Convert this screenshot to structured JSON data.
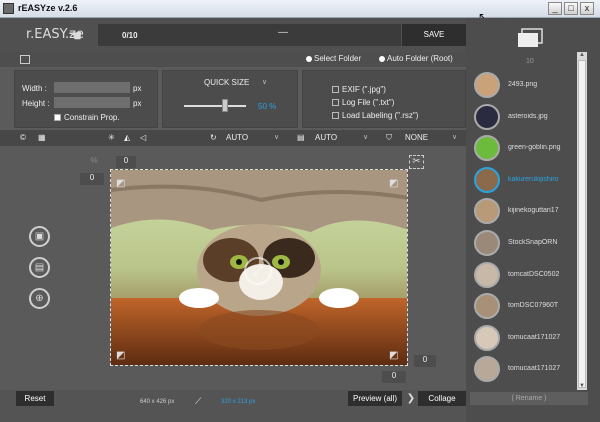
{
  "window": {
    "title": "rEASYze v.2.6",
    "controls": [
      "_",
      "□",
      "x"
    ]
  },
  "header": {
    "logo": "r.EASY.ze",
    "counter": "0/10",
    "progress_text": "—",
    "save_label": "SAVE"
  },
  "folder": {
    "select_label": "Select Folder",
    "auto_label": "Auto Folder (Root)"
  },
  "size": {
    "width_label": "Width :",
    "height_label": "Height :",
    "width_value": "",
    "height_value": "",
    "unit": "px",
    "constrain_label": "Constrain Prop."
  },
  "quick": {
    "label": "QUICK SIZE",
    "percent": "50 %",
    "slider_value_percent": 50
  },
  "options": {
    "exif": "EXIF (\".jpg\")",
    "log": "Log File (\".txt\")",
    "labeling": "Load Labeling (\".rsz\")"
  },
  "toolbar": {
    "rotate_value": "AUTO",
    "format_value": "AUTO",
    "filter_value": "NONE"
  },
  "canvas": {
    "pct_symbol": "%",
    "top_num": "0",
    "left_num": "0",
    "right_num": "0",
    "bottom_num": "0"
  },
  "bottom": {
    "reset_label": "Reset",
    "original_dims": "640 x 426 px",
    "new_dims": "320 x 213 px",
    "preview_label": "Preview (all)",
    "collage_label": "Collage"
  },
  "files": {
    "count": "10",
    "items": [
      {
        "name": "2493.png",
        "color": "#c9a27a"
      },
      {
        "name": "asteroids.jpg",
        "color": "#2a2a40"
      },
      {
        "name": "green-goblin.png",
        "color": "#6cbb3c"
      },
      {
        "name": "kakurerukijishiro",
        "color": "#8a6a4a",
        "selected": true
      },
      {
        "name": "kijinekoguttari17",
        "color": "#b89a78"
      },
      {
        "name": "StockSnapORN",
        "color": "#9a8878"
      },
      {
        "name": "tomcatDSC0502",
        "color": "#c8b8a8"
      },
      {
        "name": "tomDSC07960T",
        "color": "#a89078"
      },
      {
        "name": "tomucaat171027",
        "color": "#d8c8b8"
      },
      {
        "name": "tomucaat171027",
        "color": "#b8a898"
      }
    ],
    "rename_label": "( Rename )"
  }
}
